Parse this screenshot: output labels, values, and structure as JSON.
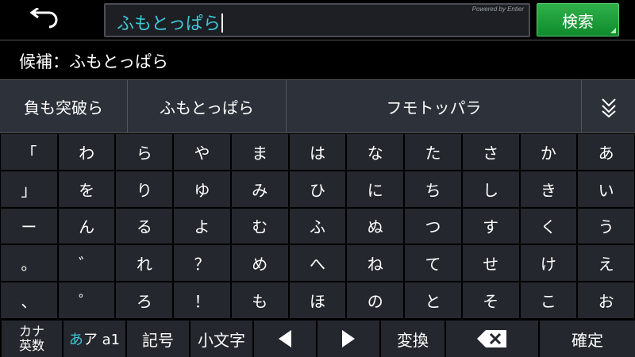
{
  "header": {
    "back_icon": "back-arrow-icon",
    "search_value": "ふもとっぱら",
    "powered_by": "Powered by Entier",
    "search_button": "検索",
    "accent_color": "#3cc8d8",
    "search_button_color": "#1f9e3c"
  },
  "candidate": {
    "text": "候補：ふもとっぱら"
  },
  "conversion": {
    "items": [
      "負も突破ら",
      "ふもとっぱら",
      "フモトッパラ"
    ],
    "more_icon": "double-chevron-down-icon"
  },
  "keyboard": {
    "rows": [
      [
        "「",
        "わ",
        "ら",
        "や",
        "ま",
        "は",
        "な",
        "た",
        "さ",
        "か",
        "あ"
      ],
      [
        "」",
        "を",
        "り",
        "ゆ",
        "み",
        "ひ",
        "に",
        "ち",
        "し",
        "き",
        "い"
      ],
      [
        "ー",
        "ん",
        "る",
        "よ",
        "む",
        "ふ",
        "ぬ",
        "つ",
        "す",
        "く",
        "う"
      ],
      [
        "。",
        "゛",
        "れ",
        "？",
        "め",
        "へ",
        "ね",
        "て",
        "せ",
        "け",
        "え"
      ],
      [
        "、",
        "゜",
        "ろ",
        "！",
        "も",
        "ほ",
        "の",
        "と",
        "そ",
        "こ",
        "お"
      ]
    ]
  },
  "bottom": {
    "kana_line1": "カナ",
    "kana_line2": "英数",
    "mode_hira": "あ",
    "mode_rest": "ア a1",
    "symbols": "記号",
    "small_chars": "小文字",
    "left_icon": "left-triangle-icon",
    "right_icon": "right-triangle-icon",
    "convert": "変換",
    "backspace_icon": "backspace-icon",
    "confirm": "確定"
  }
}
